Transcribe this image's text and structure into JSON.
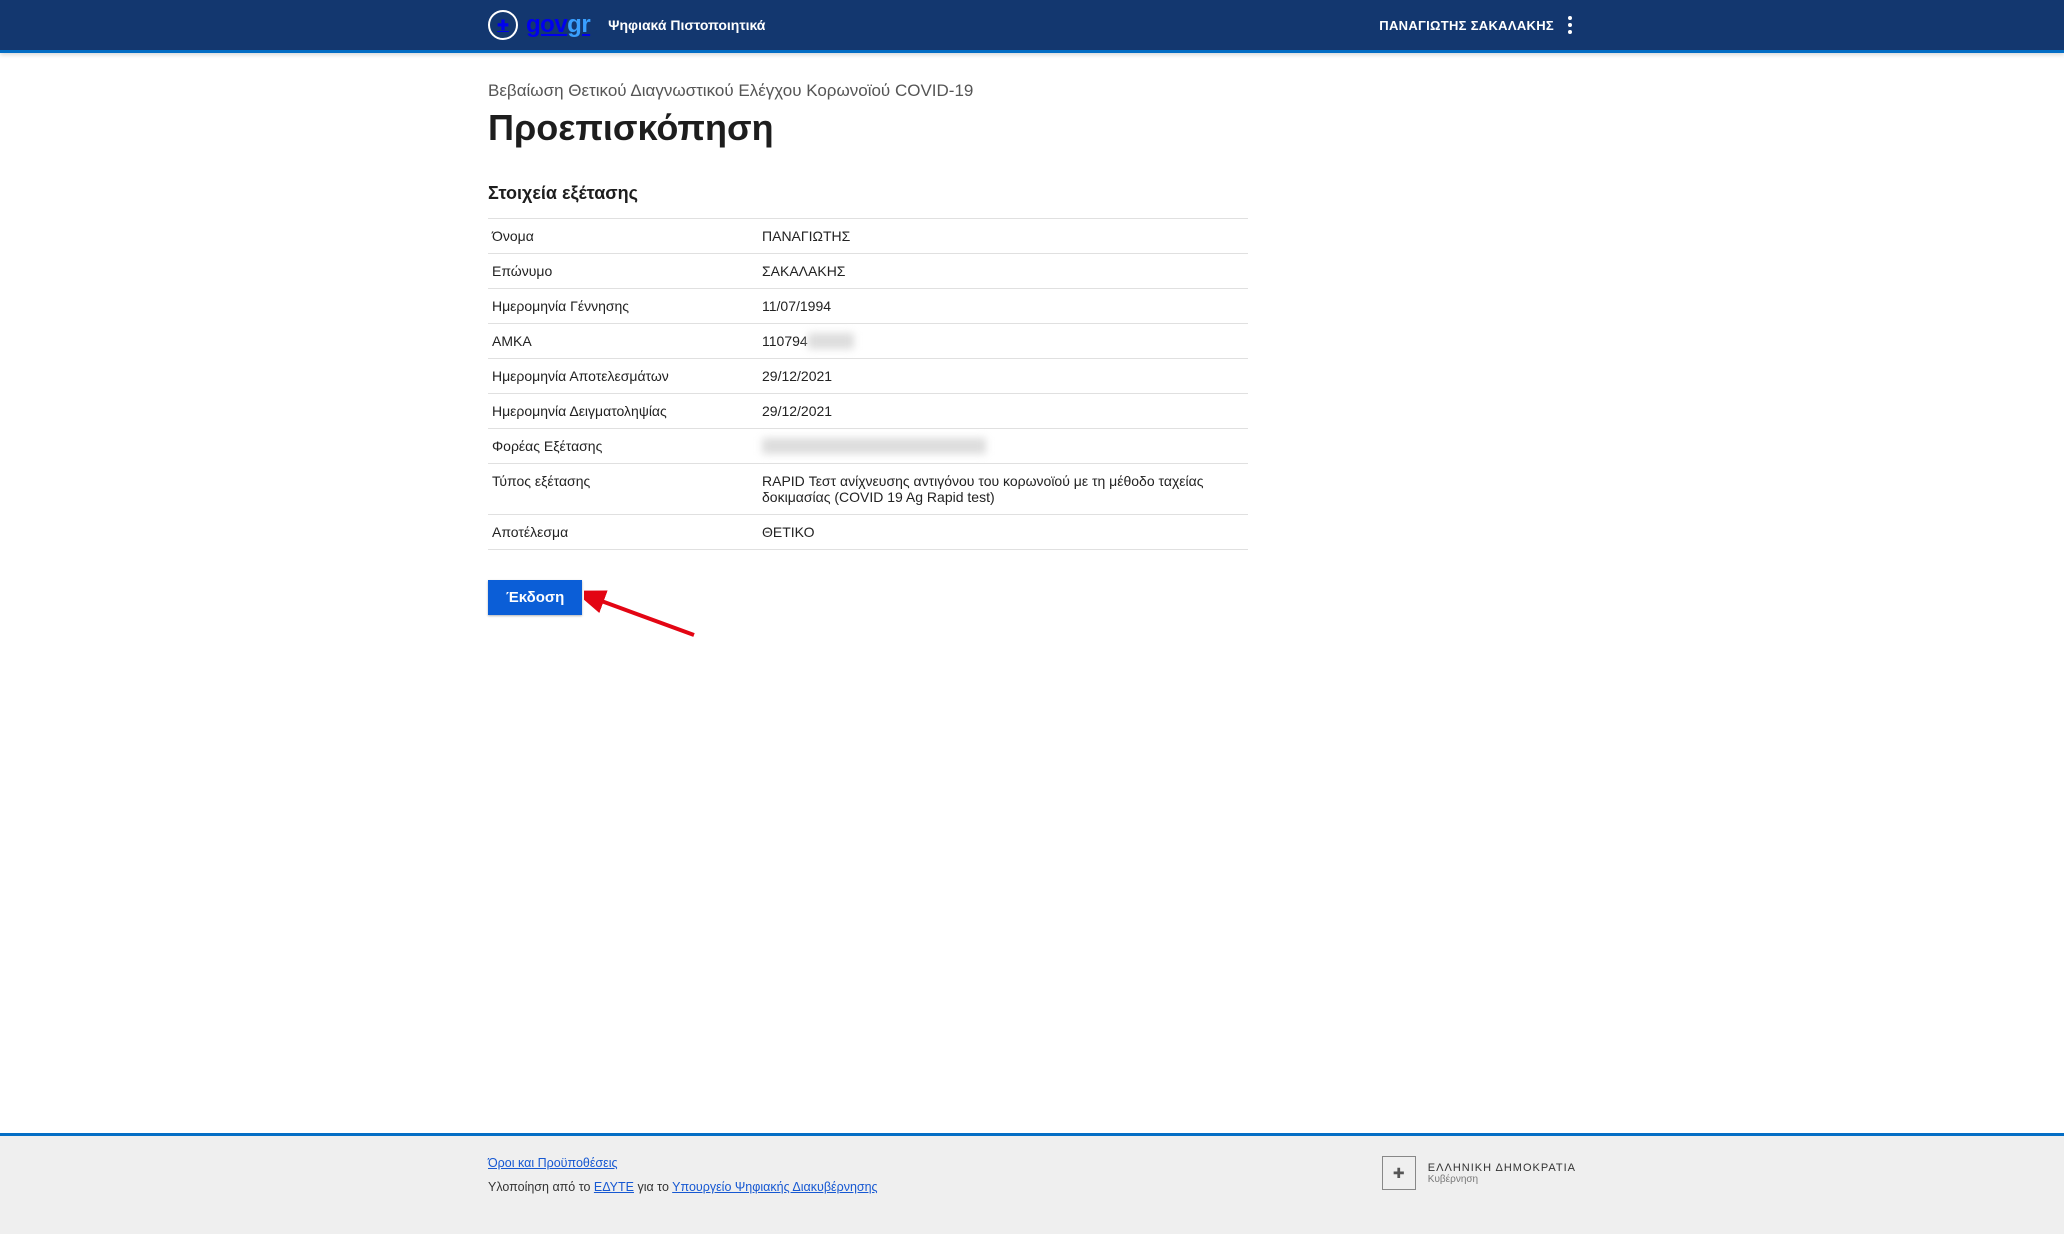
{
  "header": {
    "logo_gov": "gov",
    "logo_gr": "gr",
    "subtitle": "Ψηφιακά Πιστοποιητικά",
    "user_name": "ΠΑΝΑΓΙΩΤΗΣ ΣΑΚΑΛΑΚΗΣ"
  },
  "page": {
    "breadcrumb": "Βεβαίωση Θετικού Διαγνωστικού Ελέγχου Κορωνοϊού COVID-19",
    "title": "Προεπισκόπηση",
    "section_title": "Στοιχεία εξέτασης"
  },
  "fields": [
    {
      "label": "Όνομα",
      "value": "ΠΑΝΑΓΙΩΤΗΣ"
    },
    {
      "label": "Επώνυμο",
      "value": "ΣΑΚΑΛΑΚΗΣ"
    },
    {
      "label": "Ημερομηνία Γέννησης",
      "value": "11/07/1994"
    },
    {
      "label": "ΑΜΚΑ",
      "value": "110794",
      "value_suffix_redacted": "XXXXX"
    },
    {
      "label": "Ημερομηνία Αποτελεσμάτων",
      "value": "29/12/2021"
    },
    {
      "label": "Ημερομηνία Δειγματοληψίας",
      "value": "29/12/2021"
    },
    {
      "label": "Φορέας Εξέτασης",
      "value_redacted": "XXXXXXXXXXXXXXXXXXXXXXXX"
    },
    {
      "label": "Τύπος εξέτασης",
      "value": "RAPID Τεστ ανίχνευσης αντιγόνου του κορωνοϊού με τη μέθοδο ταχείας δοκιμασίας (COVID 19 Ag Rapid test)"
    },
    {
      "label": "Αποτέλεσμα",
      "value": "ΘΕΤΙΚΟ"
    }
  ],
  "actions": {
    "issue": "Έκδοση"
  },
  "footer": {
    "terms": "Όροι και Προϋποθέσεις",
    "impl_prefix": "Υλοποίηση από το ",
    "edyte": "ΕΔΥΤΕ",
    "impl_mid": " για το ",
    "ministry": "Υπουργείο Ψηφιακής Διακυβέρνησης",
    "republic_line1": "ΕΛΛΗΝΙΚΗ ΔΗΜΟΚΡΑΤΙΑ",
    "republic_line2": "Κυβέρνηση"
  }
}
